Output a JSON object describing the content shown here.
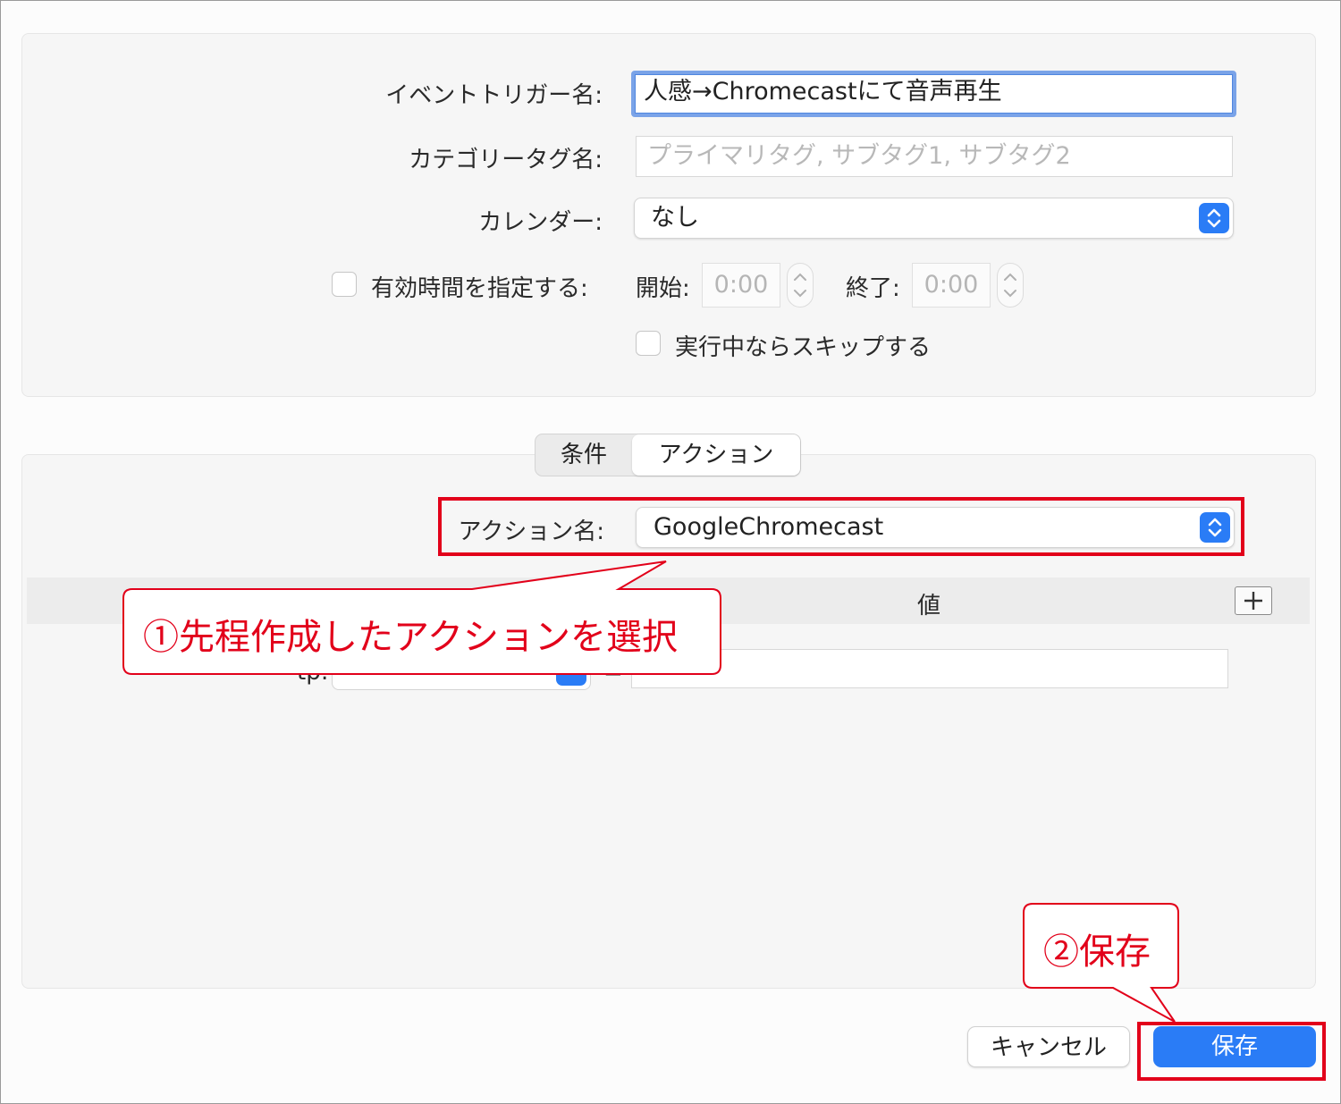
{
  "form": {
    "trigger_name_label": "イベントトリガー名:",
    "trigger_name_value": "人感→Chromecastにて音声再生",
    "category_label": "カテゴリータグ名:",
    "category_placeholder": "プライマリタグ, サブタグ1, サブタグ2",
    "calendar_label": "カレンダー:",
    "calendar_value": "なし",
    "valid_time_label": "有効時間を指定する:",
    "start_label": "開始:",
    "start_value": "0:00",
    "end_label": "終了:",
    "end_value": "0:00",
    "skip_label": "実行中ならスキップする"
  },
  "tabs": {
    "conditions": "条件",
    "actions": "アクション"
  },
  "action": {
    "name_label": "アクション名:",
    "name_value": "GoogleChromecast",
    "value_header": "値",
    "param_label_fragment": "tp:",
    "equals": "="
  },
  "annotations": {
    "note1": "①先程作成したアクションを選択",
    "note2": "②保存",
    "color": "#e2001a"
  },
  "buttons": {
    "cancel": "キャンセル",
    "save": "保存"
  },
  "colors": {
    "accent": "#2a7cf6",
    "focus_ring": "#7aa3e8"
  }
}
